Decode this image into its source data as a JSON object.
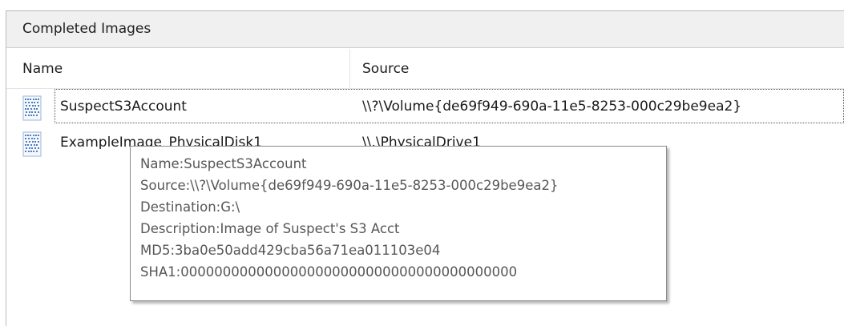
{
  "panel": {
    "title": "Completed Images"
  },
  "columns": {
    "name": "Name",
    "source": "Source"
  },
  "rows": [
    {
      "name": "SuspectS3Account",
      "source": "\\\\?\\Volume{de69f949-690a-11e5-8253-000c29be9ea2}",
      "icon": "disk-image-icon"
    },
    {
      "name": "ExampleImage_PhysicalDisk1",
      "source": "\\\\.\\PhysicalDrive1",
      "icon": "disk-image-icon"
    }
  ],
  "tooltip": {
    "name": "Name:SuspectS3Account",
    "source": "Source:\\\\?\\Volume{de69f949-690a-11e5-8253-000c29be9ea2}",
    "destination": "Destination:G:\\",
    "description": "Description:Image of Suspect's S3 Acct",
    "md5": "MD5:3ba0e50add429cba56a71ea011103e04",
    "sha1": "SHA1:0000000000000000000000000000000000000000"
  },
  "colors": {
    "header_bg": "#f0f0f0",
    "tooltip_text": "#575757",
    "icon_blue": "#4f7fc0"
  }
}
